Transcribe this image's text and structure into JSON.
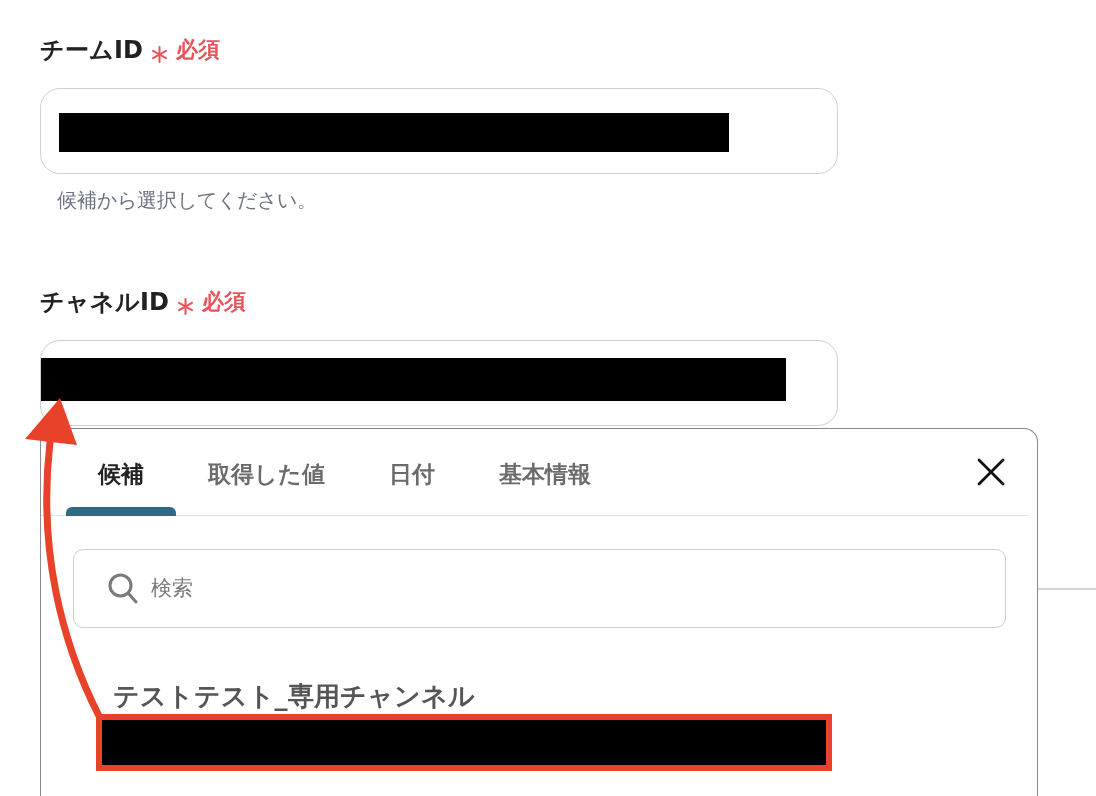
{
  "fields": [
    {
      "label": "チームID",
      "required": true,
      "required_label": "必須",
      "value_redacted": true,
      "hint": "候補から選択してください。"
    },
    {
      "label": "チャネルID",
      "required": true,
      "required_label": "必須",
      "value_redacted": true
    }
  ],
  "popup": {
    "tabs": [
      {
        "label": "候補",
        "selected": true
      },
      {
        "label": "取得した値",
        "selected": false
      },
      {
        "label": "日付",
        "selected": false
      },
      {
        "label": "基本情報",
        "selected": false
      }
    ],
    "search": {
      "placeholder": "検索"
    },
    "options": [
      {
        "title": "テストテスト_専用チャンネル",
        "value_redacted": true,
        "highlighted": true
      }
    ]
  },
  "annotation": {
    "kind": "arrow"
  }
}
